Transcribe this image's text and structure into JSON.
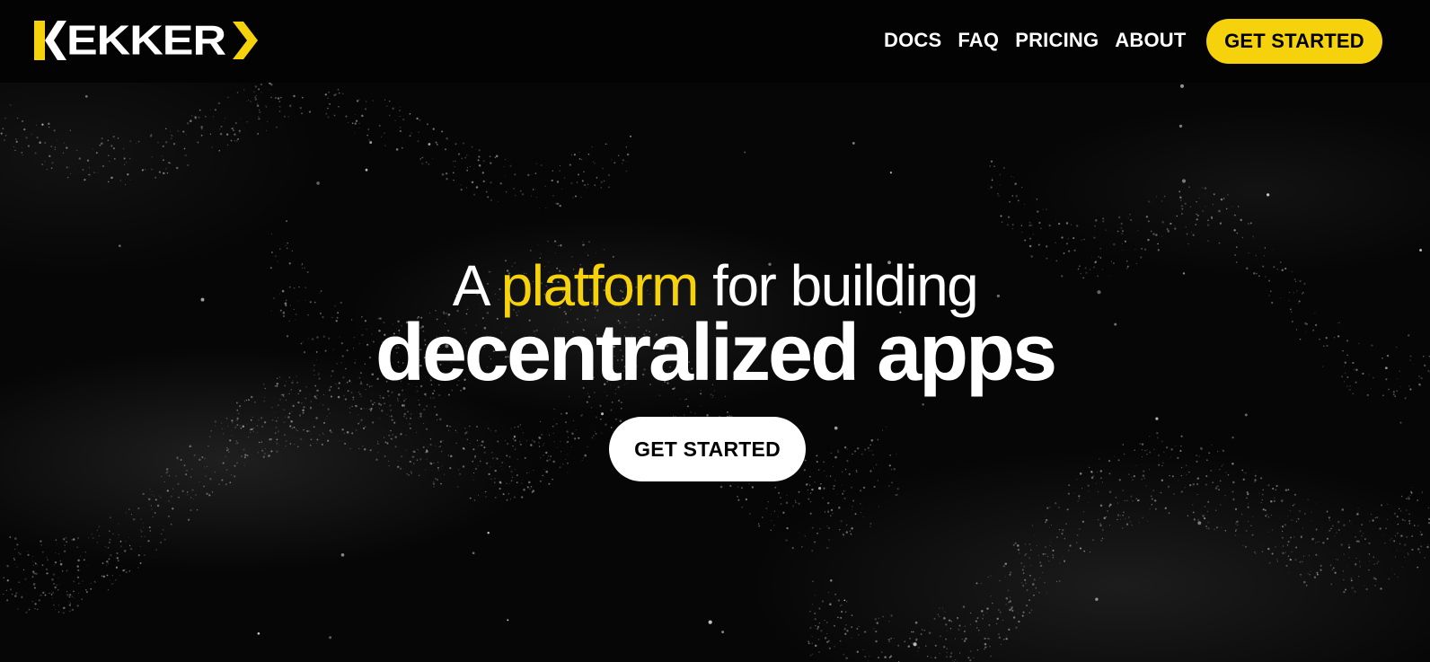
{
  "brand": {
    "name": "KEKKER",
    "logo_icon": "k-chevron-logo",
    "accent_color": "#f6d20d"
  },
  "nav": {
    "links": [
      "DOCS",
      "FAQ",
      "PRICING",
      "ABOUT"
    ],
    "cta_label": "GET STARTED"
  },
  "hero": {
    "line1_prefix": "A",
    "line1_accent": "platform",
    "line1_suffix": "for building",
    "line2": "decentralized apps",
    "cta_label": "GET STARTED"
  }
}
